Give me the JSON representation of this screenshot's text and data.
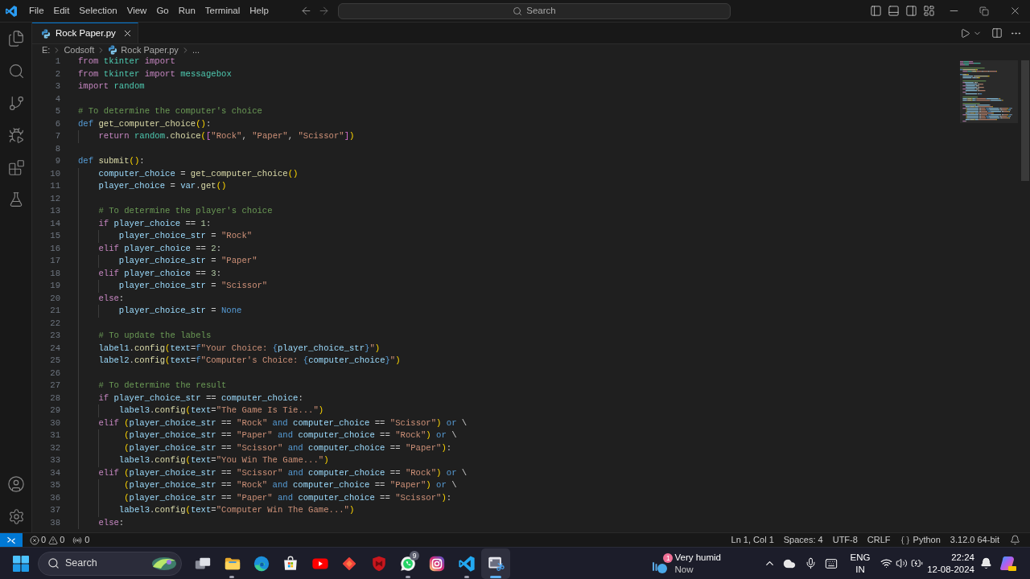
{
  "title_bar": {
    "menu": [
      "File",
      "Edit",
      "Selection",
      "View",
      "Go",
      "Run",
      "Terminal",
      "Help"
    ],
    "search": {
      "label": "Search"
    }
  },
  "tabs": [
    {
      "label": "Rock Paper.py",
      "selected": true
    }
  ],
  "breadcrumb": [
    {
      "kind": "folder",
      "text": "E:"
    },
    {
      "kind": "folder",
      "text": "Codsoft"
    },
    {
      "kind": "file",
      "text": "Rock Paper.py"
    },
    {
      "kind": "symbol",
      "text": "..."
    }
  ],
  "editor": {
    "lines": [
      {
        "number": "1",
        "code": [
          {
            "kind": "keyword",
            "text": "from "
          },
          {
            "kind": "module",
            "text": "tkinter "
          },
          {
            "kind": "keyword",
            "text": "import"
          }
        ]
      },
      {
        "number": "2",
        "code": [
          {
            "kind": "keyword",
            "text": "from "
          },
          {
            "kind": "module",
            "text": "tkinter "
          },
          {
            "kind": "keyword",
            "text": "import "
          },
          {
            "kind": "module",
            "text": "messagebox"
          }
        ]
      },
      {
        "number": "3",
        "code": [
          {
            "kind": "keyword",
            "text": "import "
          },
          {
            "kind": "module",
            "text": "random"
          }
        ]
      },
      {
        "number": "4"
      },
      {
        "number": "5",
        "code": [
          {
            "kind": "comment",
            "text": "# To determine the computer's choice"
          }
        ]
      },
      {
        "number": "6",
        "code": [
          {
            "kind": "storage",
            "text": "def "
          },
          {
            "kind": "function",
            "text": "get_computer_choice"
          },
          {
            "kind": "bracket",
            "text": "()"
          },
          {
            "kind": "plain",
            "text": ":"
          }
        ]
      },
      {
        "number": "7",
        "code": [
          {
            "kind": "keyword",
            "text": "    return "
          },
          {
            "kind": "module",
            "text": "random"
          },
          {
            "kind": "plain",
            "text": "."
          },
          {
            "kind": "function",
            "text": "choice"
          },
          {
            "kind": "bracket",
            "text": "("
          },
          {
            "kind": "nested",
            "text": "["
          },
          {
            "kind": "string",
            "text": "\"Rock\""
          },
          {
            "kind": "plain",
            "text": ", "
          },
          {
            "kind": "string",
            "text": "\"Paper\""
          },
          {
            "kind": "plain",
            "text": ", "
          },
          {
            "kind": "string",
            "text": "\"Scissor\""
          },
          {
            "kind": "nested",
            "text": "]"
          },
          {
            "kind": "bracket",
            "text": ")"
          }
        ]
      },
      {
        "number": "8"
      },
      {
        "number": "9",
        "code": [
          {
            "kind": "storage",
            "text": "def "
          },
          {
            "kind": "function",
            "text": "submit"
          },
          {
            "kind": "bracket",
            "text": "()"
          },
          {
            "kind": "plain",
            "text": ":"
          }
        ]
      },
      {
        "number": "10",
        "code": [
          {
            "kind": "variable",
            "text": "    computer_choice"
          },
          {
            "kind": "plain",
            "text": " = "
          },
          {
            "kind": "function",
            "text": "get_computer_choice"
          },
          {
            "kind": "bracket",
            "text": "()"
          }
        ]
      },
      {
        "number": "11",
        "code": [
          {
            "kind": "variable",
            "text": "    player_choice"
          },
          {
            "kind": "plain",
            "text": " = "
          },
          {
            "kind": "variable",
            "text": "var"
          },
          {
            "kind": "plain",
            "text": "."
          },
          {
            "kind": "function",
            "text": "get"
          },
          {
            "kind": "bracket",
            "text": "()"
          }
        ]
      },
      {
        "number": "12"
      },
      {
        "number": "13",
        "code": [
          {
            "kind": "comment",
            "text": "    # To determine the player's choice"
          }
        ]
      },
      {
        "number": "14",
        "code": [
          {
            "kind": "keyword",
            "text": "    if "
          },
          {
            "kind": "variable",
            "text": "player_choice"
          },
          {
            "kind": "plain",
            "text": " == "
          },
          {
            "kind": "number",
            "text": "1"
          },
          {
            "kind": "plain",
            "text": ":"
          }
        ]
      },
      {
        "number": "15",
        "code": [
          {
            "kind": "variable",
            "text": "        player_choice_str"
          },
          {
            "kind": "plain",
            "text": " = "
          },
          {
            "kind": "string",
            "text": "\"Rock\""
          }
        ]
      },
      {
        "number": "16",
        "code": [
          {
            "kind": "keyword",
            "text": "    elif "
          },
          {
            "kind": "variable",
            "text": "player_choice"
          },
          {
            "kind": "plain",
            "text": " == "
          },
          {
            "kind": "number",
            "text": "2"
          },
          {
            "kind": "plain",
            "text": ":"
          }
        ]
      },
      {
        "number": "17",
        "code": [
          {
            "kind": "variable",
            "text": "        player_choice_str"
          },
          {
            "kind": "plain",
            "text": " = "
          },
          {
            "kind": "string",
            "text": "\"Paper\""
          }
        ]
      },
      {
        "number": "18",
        "code": [
          {
            "kind": "keyword",
            "text": "    elif "
          },
          {
            "kind": "variable",
            "text": "player_choice"
          },
          {
            "kind": "plain",
            "text": " == "
          },
          {
            "kind": "number",
            "text": "3"
          },
          {
            "kind": "plain",
            "text": ":"
          }
        ]
      },
      {
        "number": "19",
        "code": [
          {
            "kind": "variable",
            "text": "        player_choice_str"
          },
          {
            "kind": "plain",
            "text": " = "
          },
          {
            "kind": "string",
            "text": "\"Scissor\""
          }
        ]
      },
      {
        "number": "20",
        "code": [
          {
            "kind": "keyword",
            "text": "    else"
          },
          {
            "kind": "plain",
            "text": ":"
          }
        ]
      },
      {
        "number": "21",
        "code": [
          {
            "kind": "variable",
            "text": "        player_choice_str"
          },
          {
            "kind": "plain",
            "text": " = "
          },
          {
            "kind": "storage",
            "text": "None"
          }
        ]
      },
      {
        "number": "22"
      },
      {
        "number": "23",
        "code": [
          {
            "kind": "comment",
            "text": "    # To update the labels"
          }
        ]
      },
      {
        "number": "24",
        "code": [
          {
            "kind": "variable",
            "text": "    label1"
          },
          {
            "kind": "plain",
            "text": "."
          },
          {
            "kind": "function",
            "text": "config"
          },
          {
            "kind": "bracket",
            "text": "("
          },
          {
            "kind": "variable",
            "text": "text"
          },
          {
            "kind": "plain",
            "text": "="
          },
          {
            "kind": "storage",
            "text": "f"
          },
          {
            "kind": "string",
            "text": "\"Your Choice: "
          },
          {
            "kind": "storage",
            "text": "{"
          },
          {
            "kind": "variable",
            "text": "player_choice_str"
          },
          {
            "kind": "storage",
            "text": "}"
          },
          {
            "kind": "string",
            "text": "\""
          },
          {
            "kind": "bracket",
            "text": ")"
          }
        ]
      },
      {
        "number": "25",
        "code": [
          {
            "kind": "variable",
            "text": "    label2"
          },
          {
            "kind": "plain",
            "text": "."
          },
          {
            "kind": "function",
            "text": "config"
          },
          {
            "kind": "bracket",
            "text": "("
          },
          {
            "kind": "variable",
            "text": "text"
          },
          {
            "kind": "plain",
            "text": "="
          },
          {
            "kind": "storage",
            "text": "f"
          },
          {
            "kind": "string",
            "text": "\"Computer's Choice: "
          },
          {
            "kind": "storage",
            "text": "{"
          },
          {
            "kind": "variable",
            "text": "computer_choice"
          },
          {
            "kind": "storage",
            "text": "}"
          },
          {
            "kind": "string",
            "text": "\""
          },
          {
            "kind": "bracket",
            "text": ")"
          }
        ]
      },
      {
        "number": "26"
      },
      {
        "number": "27",
        "code": [
          {
            "kind": "comment",
            "text": "    # To determine the result"
          }
        ]
      },
      {
        "number": "28",
        "code": [
          {
            "kind": "keyword",
            "text": "    if "
          },
          {
            "kind": "variable",
            "text": "player_choice_str"
          },
          {
            "kind": "plain",
            "text": " == "
          },
          {
            "kind": "variable",
            "text": "computer_choice"
          },
          {
            "kind": "plain",
            "text": ":"
          }
        ]
      },
      {
        "number": "29",
        "code": [
          {
            "kind": "variable",
            "text": "        label3"
          },
          {
            "kind": "plain",
            "text": "."
          },
          {
            "kind": "function",
            "text": "config"
          },
          {
            "kind": "bracket",
            "text": "("
          },
          {
            "kind": "variable",
            "text": "text"
          },
          {
            "kind": "plain",
            "text": "="
          },
          {
            "kind": "string",
            "text": "\"The Game Is Tie...\""
          },
          {
            "kind": "bracket",
            "text": ")"
          }
        ]
      },
      {
        "number": "30",
        "code": [
          {
            "kind": "keyword",
            "text": "    elif "
          },
          {
            "kind": "bracket",
            "text": "("
          },
          {
            "kind": "variable",
            "text": "player_choice_str"
          },
          {
            "kind": "plain",
            "text": " == "
          },
          {
            "kind": "string",
            "text": "\"Rock\""
          },
          {
            "kind": "storage",
            "text": " and "
          },
          {
            "kind": "variable",
            "text": "computer_choice"
          },
          {
            "kind": "plain",
            "text": " == "
          },
          {
            "kind": "string",
            "text": "\"Scissor\""
          },
          {
            "kind": "bracket",
            "text": ")"
          },
          {
            "kind": "storage",
            "text": " or "
          },
          {
            "kind": "plain",
            "text": "\\"
          }
        ]
      },
      {
        "number": "31",
        "code": [
          {
            "kind": "bracket",
            "text": "         ("
          },
          {
            "kind": "variable",
            "text": "player_choice_str"
          },
          {
            "kind": "plain",
            "text": " == "
          },
          {
            "kind": "string",
            "text": "\"Paper\""
          },
          {
            "kind": "storage",
            "text": " and "
          },
          {
            "kind": "variable",
            "text": "computer_choice"
          },
          {
            "kind": "plain",
            "text": " == "
          },
          {
            "kind": "string",
            "text": "\"Rock\""
          },
          {
            "kind": "bracket",
            "text": ")"
          },
          {
            "kind": "storage",
            "text": " or "
          },
          {
            "kind": "plain",
            "text": "\\"
          }
        ]
      },
      {
        "number": "32",
        "code": [
          {
            "kind": "bracket",
            "text": "         ("
          },
          {
            "kind": "variable",
            "text": "player_choice_str"
          },
          {
            "kind": "plain",
            "text": " == "
          },
          {
            "kind": "string",
            "text": "\"Scissor\""
          },
          {
            "kind": "storage",
            "text": " and "
          },
          {
            "kind": "variable",
            "text": "computer_choice"
          },
          {
            "kind": "plain",
            "text": " == "
          },
          {
            "kind": "string",
            "text": "\"Paper\""
          },
          {
            "kind": "bracket",
            "text": ")"
          },
          {
            "kind": "plain",
            "text": ":"
          }
        ]
      },
      {
        "number": "33",
        "code": [
          {
            "kind": "variable",
            "text": "        label3"
          },
          {
            "kind": "plain",
            "text": "."
          },
          {
            "kind": "function",
            "text": "config"
          },
          {
            "kind": "bracket",
            "text": "("
          },
          {
            "kind": "variable",
            "text": "text"
          },
          {
            "kind": "plain",
            "text": "="
          },
          {
            "kind": "string",
            "text": "\"You Win The Game...\""
          },
          {
            "kind": "bracket",
            "text": ")"
          }
        ]
      },
      {
        "number": "34",
        "code": [
          {
            "kind": "keyword",
            "text": "    elif "
          },
          {
            "kind": "bracket",
            "text": "("
          },
          {
            "kind": "variable",
            "text": "player_choice_str"
          },
          {
            "kind": "plain",
            "text": " == "
          },
          {
            "kind": "string",
            "text": "\"Scissor\""
          },
          {
            "kind": "storage",
            "text": " and "
          },
          {
            "kind": "variable",
            "text": "computer_choice"
          },
          {
            "kind": "plain",
            "text": " == "
          },
          {
            "kind": "string",
            "text": "\"Rock\""
          },
          {
            "kind": "bracket",
            "text": ")"
          },
          {
            "kind": "storage",
            "text": " or "
          },
          {
            "kind": "plain",
            "text": "\\"
          }
        ]
      },
      {
        "number": "35",
        "code": [
          {
            "kind": "bracket",
            "text": "         ("
          },
          {
            "kind": "variable",
            "text": "player_choice_str"
          },
          {
            "kind": "plain",
            "text": " == "
          },
          {
            "kind": "string",
            "text": "\"Rock\""
          },
          {
            "kind": "storage",
            "text": " and "
          },
          {
            "kind": "variable",
            "text": "computer_choice"
          },
          {
            "kind": "plain",
            "text": " == "
          },
          {
            "kind": "string",
            "text": "\"Paper\""
          },
          {
            "kind": "bracket",
            "text": ")"
          },
          {
            "kind": "storage",
            "text": " or "
          },
          {
            "kind": "plain",
            "text": "\\"
          }
        ]
      },
      {
        "number": "36",
        "code": [
          {
            "kind": "bracket",
            "text": "         ("
          },
          {
            "kind": "variable",
            "text": "player_choice_str"
          },
          {
            "kind": "plain",
            "text": " == "
          },
          {
            "kind": "string",
            "text": "\"Paper\""
          },
          {
            "kind": "storage",
            "text": " and "
          },
          {
            "kind": "variable",
            "text": "computer_choice"
          },
          {
            "kind": "plain",
            "text": " == "
          },
          {
            "kind": "string",
            "text": "\"Scissor\""
          },
          {
            "kind": "bracket",
            "text": ")"
          },
          {
            "kind": "plain",
            "text": ":"
          }
        ]
      },
      {
        "number": "37",
        "code": [
          {
            "kind": "variable",
            "text": "        label3"
          },
          {
            "kind": "plain",
            "text": "."
          },
          {
            "kind": "function",
            "text": "config"
          },
          {
            "kind": "bracket",
            "text": "("
          },
          {
            "kind": "variable",
            "text": "text"
          },
          {
            "kind": "plain",
            "text": "="
          },
          {
            "kind": "string",
            "text": "\"Computer Win The Game...\""
          },
          {
            "kind": "bracket",
            "text": ")"
          }
        ]
      },
      {
        "number": "38",
        "code": [
          {
            "kind": "keyword",
            "text": "    else"
          },
          {
            "kind": "plain",
            "text": ":"
          }
        ]
      }
    ]
  },
  "status_bar": {
    "errors": "0",
    "warnings": "0",
    "ports": "0",
    "position": "Ln 1, Col 1",
    "indentation": "Spaces: 4",
    "encoding": "UTF-8",
    "line_ending": "CRLF",
    "language": "Python",
    "interpreter": "3.12.0 64-bit"
  },
  "taskbar": {
    "search": {
      "label": "Search"
    },
    "apps": [
      {
        "kind": "taskview",
        "running": false,
        "active": false
      },
      {
        "kind": "files",
        "running": true,
        "active": false
      },
      {
        "kind": "browser",
        "running": false,
        "active": false
      },
      {
        "kind": "store",
        "running": false,
        "active": false
      },
      {
        "kind": "video",
        "running": false,
        "active": false
      },
      {
        "kind": "diamond",
        "running": false,
        "active": false
      },
      {
        "kind": "shield",
        "running": false,
        "active": false
      },
      {
        "kind": "chat",
        "running": true,
        "active": false,
        "badge": "9"
      },
      {
        "kind": "camera",
        "running": false,
        "active": false
      },
      {
        "kind": "code",
        "running": true,
        "active": false
      },
      {
        "kind": "snip",
        "running": true,
        "active": true
      }
    ],
    "weather": {
      "badge": "1",
      "condition": "Very humid",
      "time": "Now"
    },
    "input_language": [
      "ENG",
      "IN"
    ],
    "clock": {
      "time": "22:24",
      "date": "12-08-2024"
    }
  }
}
